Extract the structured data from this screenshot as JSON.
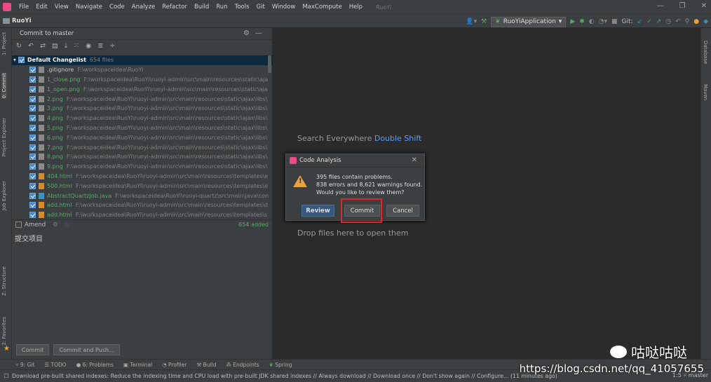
{
  "menubar": {
    "items": [
      "File",
      "Edit",
      "View",
      "Navigate",
      "Code",
      "Analyze",
      "Refactor",
      "Build",
      "Run",
      "Tools",
      "Git",
      "Window",
      "MaxCompute",
      "Help"
    ],
    "project": "RuoYi"
  },
  "navbar": {
    "project": "RuoYi",
    "run_config": "RuoYiApplication",
    "git_label": "Git:"
  },
  "left_tabs": [
    "1: Project",
    "0: Commit",
    "Project Explorer",
    "Job Explorer",
    "Z: Structure",
    "2: Favorites"
  ],
  "right_tabs": [
    "Database",
    "Maven"
  ],
  "commit_panel": {
    "title": "Commit to master",
    "changelist": {
      "name": "Default Changelist",
      "count": "654 files"
    },
    "files": [
      {
        "name": ".gitignore",
        "path": "F:\\workspaceidea\\RuoYi",
        "color": "#c0c0c0",
        "icon": "#888888"
      },
      {
        "name": "1_close.png",
        "path": "F:\\workspaceidea\\RuoYi\\ruoyi-admin\\src\\main\\resources\\static\\aja",
        "color": "#59a869",
        "icon": "#8a8a8a"
      },
      {
        "name": "1_open.png",
        "path": "F:\\workspaceidea\\RuoYi\\ruoyi-admin\\src\\main\\resources\\static\\aja",
        "color": "#59a869",
        "icon": "#8a8a8a"
      },
      {
        "name": "2.png",
        "path": "F:\\workspaceidea\\RuoYi\\ruoyi-admin\\src\\main\\resources\\static\\ajax\\libs\\",
        "color": "#59a869",
        "icon": "#8a8a8a"
      },
      {
        "name": "3.png",
        "path": "F:\\workspaceidea\\RuoYi\\ruoyi-admin\\src\\main\\resources\\static\\ajax\\libs\\",
        "color": "#59a869",
        "icon": "#8a8a8a"
      },
      {
        "name": "4.png",
        "path": "F:\\workspaceidea\\RuoYi\\ruoyi-admin\\src\\main\\resources\\static\\ajax\\libs\\",
        "color": "#59a869",
        "icon": "#8a8a8a"
      },
      {
        "name": "5.png",
        "path": "F:\\workspaceidea\\RuoYi\\ruoyi-admin\\src\\main\\resources\\static\\ajax\\libs\\",
        "color": "#59a869",
        "icon": "#8a8a8a"
      },
      {
        "name": "6.png",
        "path": "F:\\workspaceidea\\RuoYi\\ruoyi-admin\\src\\main\\resources\\static\\ajax\\libs\\",
        "color": "#59a869",
        "icon": "#8a8a8a"
      },
      {
        "name": "7.png",
        "path": "F:\\workspaceidea\\RuoYi\\ruoyi-admin\\src\\main\\resources\\static\\ajax\\libs\\",
        "color": "#59a869",
        "icon": "#8a8a8a"
      },
      {
        "name": "8.png",
        "path": "F:\\workspaceidea\\RuoYi\\ruoyi-admin\\src\\main\\resources\\static\\ajax\\libs\\",
        "color": "#59a869",
        "icon": "#8a8a8a"
      },
      {
        "name": "9.png",
        "path": "F:\\workspaceidea\\RuoYi\\ruoyi-admin\\src\\main\\resources\\static\\ajax\\libs\\",
        "color": "#59a869",
        "icon": "#8a8a8a"
      },
      {
        "name": "404.html",
        "path": "F:\\workspaceidea\\RuoYi\\ruoyi-admin\\src\\main\\resources\\templates\\e",
        "color": "#59a869",
        "icon": "#d68b2a"
      },
      {
        "name": "500.html",
        "path": "F:\\workspaceidea\\RuoYi\\ruoyi-admin\\src\\main\\resources\\templates\\e",
        "color": "#59a869",
        "icon": "#d68b2a"
      },
      {
        "name": "AbstractQuartzJob.java",
        "path": "F:\\workspaceidea\\RuoYi\\ruoyi-quartz\\src\\main\\java\\con",
        "color": "#59a869",
        "icon": "#3592c4"
      },
      {
        "name": "add.html",
        "path": "F:\\workspaceidea\\RuoYi\\ruoyi-admin\\src\\main\\resources\\templates\\d",
        "color": "#59a869",
        "icon": "#d68b2a"
      },
      {
        "name": "add.html",
        "path": "F:\\workspaceidea\\RuoYi\\ruoyi-admin\\src\\main\\resources\\templates\\s",
        "color": "#59a869",
        "icon": "#d68b2a"
      }
    ],
    "amend_label": "Amend",
    "added_label": "654 added",
    "commit_message": "提交项目",
    "commit_button": "Commit",
    "commit_push_button": "Commit and Push..."
  },
  "editor": {
    "search_hint": "Search Everywhere",
    "search_key": "Double Shift",
    "drop_hint": "Drop files here to open them"
  },
  "dialog": {
    "title": "Code Analysis",
    "line1": "395 files contain problems.",
    "line2": "838 errors and 8,621 warnings found.",
    "line3": "Would you like to review them?",
    "review": "Review",
    "commit": "Commit",
    "cancel": "Cancel"
  },
  "bottom_tabs": [
    "9: Git",
    "TODO",
    "6: Problems",
    "Terminal",
    "Profiler",
    "Build",
    "Endpoints",
    "Spring"
  ],
  "status_bar": {
    "message": "Download pre-built shared indexes: Reduce the indexing time and CPU load with pre-built JDK shared indexes // Always download // Download once // Don't show again // Configure... (11 minutes ago)",
    "position": "1:5",
    "branch": "master"
  },
  "watermark": {
    "text": "咕哒咕哒",
    "url": "https://blog.csdn.net/qq_41057655"
  },
  "colors": {
    "accent": "#3592c4",
    "selection": "#0d293e",
    "highlight_box": "#e0262a"
  }
}
